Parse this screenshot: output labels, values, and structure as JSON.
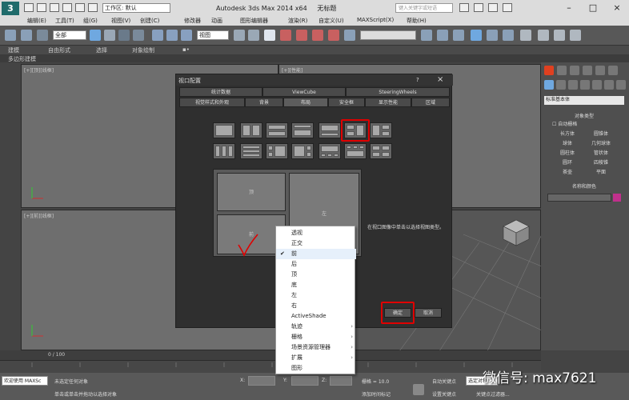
{
  "app": {
    "title": "Autodesk 3ds Max  2014 x64",
    "doc": "无标题",
    "workspace": "工作区: 默认",
    "search_placeholder": "键入关键字或短语"
  },
  "menu": [
    "编辑(E)",
    "工具(T)",
    "组(G)",
    "视图(V)",
    "创建(C)",
    "修改器",
    "动画",
    "图形编辑器",
    "渲染(R)",
    "自定义(U)",
    "MAXScript(X)",
    "帮助(H)"
  ],
  "toolbar": {
    "selection_filter": "全部",
    "ref_coord": "视图"
  },
  "ribbon": {
    "tabs": [
      "建模",
      "自由形式",
      "选择",
      "对象绘制"
    ],
    "sub": "多边形建模"
  },
  "viewports": {
    "top_left_label": "[+][顶][线框]",
    "top_right_label": "[+][左][线框]",
    "bottom_left_label": "[+][前][线框]",
    "top_left_mid_label": "[+][性能]"
  },
  "command_panel": {
    "category": "标准基本体",
    "rollout_type": "对象类型",
    "autogrid": "自动栅格",
    "objects": [
      "长方体",
      "圆锥体",
      "球体",
      "几何球体",
      "圆柱体",
      "管状体",
      "圆环",
      "四棱锥",
      "茶壶",
      "平面"
    ],
    "rollout_name": "名称和颜色"
  },
  "dialog": {
    "title": "视口配置",
    "help": "?",
    "close": "×",
    "tabs_row1": [
      "统计数据",
      "ViewCube",
      "SteeringWheels"
    ],
    "tabs_row2": [
      "视觉样式和外观",
      "背景",
      "布局",
      "安全框",
      "显示性能",
      "区域"
    ],
    "preview_labels": [
      "顶",
      "左",
      "前"
    ],
    "hint": "在视口图像中单击以选择视图类型。",
    "ok": "确定",
    "cancel": "取消"
  },
  "context_menu": {
    "items": [
      "透视",
      "正交",
      "前",
      "后",
      "顶",
      "底",
      "左",
      "右",
      "ActiveShade",
      "轨迹",
      "栅格",
      "场景资源管理器",
      "扩展",
      "图形"
    ],
    "checked": "前",
    "submenu": [
      "轨迹",
      "栅格",
      "场景资源管理器",
      "扩展"
    ]
  },
  "timeline": {
    "frame": "0 / 100"
  },
  "status": {
    "welcome": "欢迎使用 MAXSc",
    "msg1": "未选定任何对象",
    "msg2": "单击或单击并拖动以选择对象",
    "x_label": "X:",
    "y_label": "Y:",
    "z_label": "Z:",
    "grid": "栅格 = 10.0",
    "autokey": "自动关键点",
    "selected": "选定对象",
    "setkey": "设置关键点",
    "keyfilter": "关键点过滤器...",
    "addtime": "添加时间标记"
  },
  "annotation": {
    "checkmark_1": "✓",
    "checkmark_2": "✓"
  },
  "watermark": "微信号: max7621",
  "colors": {
    "highlight": "#e00000",
    "object_color": "#c0308c"
  }
}
